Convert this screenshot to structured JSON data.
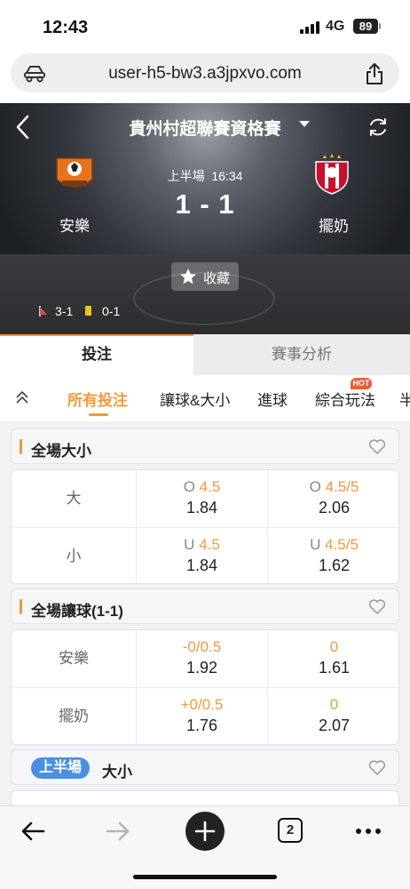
{
  "status_bar": {
    "time": "12:43",
    "network": "4G",
    "battery": "89"
  },
  "browser": {
    "url": "user-h5-bw3.a3jpxvo.com",
    "tab_count": "2"
  },
  "match": {
    "league": "貴州村超聯賽資格賽",
    "period": "上半場",
    "clock": "16:34",
    "score": "1 - 1",
    "home_team": "安樂",
    "away_team": "擺奶",
    "favorite_label": "收藏",
    "corners": "3-1",
    "yellow_cards": "0-1"
  },
  "main_tabs": [
    {
      "label": "投注",
      "active": true
    },
    {
      "label": "賽事分析",
      "active": false
    }
  ],
  "sub_tabs": [
    {
      "label": "所有投注",
      "active": true
    },
    {
      "label": "讓球&大小",
      "active": false
    },
    {
      "label": "進球",
      "active": false
    },
    {
      "label": "綜合玩法",
      "active": false,
      "badge": "HOT"
    },
    {
      "label": "半",
      "active": false
    }
  ],
  "markets": {
    "ou_full": {
      "title": "全場大小",
      "rows": [
        {
          "label": "大",
          "c1_prefix": "O",
          "c1_line": "4.5",
          "c1_odds": "1.84",
          "c2_prefix": "O",
          "c2_line": "4.5/5",
          "c2_odds": "2.06"
        },
        {
          "label": "小",
          "c1_prefix": "U",
          "c1_line": "4.5",
          "c1_odds": "1.84",
          "c2_prefix": "U",
          "c2_line": "4.5/5",
          "c2_odds": "1.62"
        }
      ]
    },
    "handicap_full": {
      "title": "全場讓球(1-1)",
      "rows": [
        {
          "label": "安樂",
          "c1_line": "-0/0.5",
          "c1_odds": "1.92",
          "c2_line": "0",
          "c2_odds": "1.61"
        },
        {
          "label": "擺奶",
          "c1_line": "+0/0.5",
          "c1_odds": "1.76",
          "c2_line": "0",
          "c2_odds": "2.07"
        }
      ]
    },
    "ou_first_half": {
      "badge": "上半場",
      "title": "大小"
    }
  },
  "colors": {
    "accent": "#f29a3a",
    "badge_blue": "#4a90e2",
    "hot_red": "#f05a3a"
  },
  "icons": [
    "site-icon",
    "share-icon",
    "back-icon",
    "refresh-icon",
    "star-icon",
    "corner-flag-icon",
    "yellow-card-icon",
    "collapse-icon",
    "heart-icon",
    "arrow-left-icon",
    "arrow-right-icon",
    "plus-icon",
    "tabs-icon",
    "more-icon"
  ]
}
